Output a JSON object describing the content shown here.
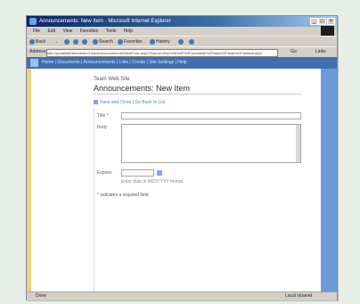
{
  "window": {
    "title": "Announcements: New Item - Microsoft Internet Explorer",
    "controls": [
      "_",
      "□",
      "×"
    ]
  },
  "menu": [
    "File",
    "Edit",
    "View",
    "Favorites",
    "Tools",
    "Help"
  ],
  "toolbar": {
    "back": "Back",
    "forward": "→",
    "search": "Search",
    "favorites": "Favorites",
    "history": "History"
  },
  "address": {
    "label": "Address",
    "value": "http://portalsite/sites/team/Lists/Announcements/NewForm.aspx?Source=http%3A%2F%2Fportalsite%2Fsites%2Fteam%2Fdefault.aspx",
    "go": "Go",
    "links": "Links"
  },
  "sharepoint": {
    "nav_text": "Home | Documents | Announcements | Lists | Create | Site Settings | Help",
    "site_title": "Team Web Site",
    "page_title": "Announcements: New Item",
    "form_toolbar": "Save and Close | Go Back to List",
    "fields": {
      "title_label": "Title *",
      "body_label": "Body",
      "expires_label": "Expires",
      "expires_hint": "Enter date in M/D/YYYY format."
    },
    "required_note": "* indicates a required field"
  },
  "status": {
    "left": "Done",
    "right": "Local intranet"
  }
}
